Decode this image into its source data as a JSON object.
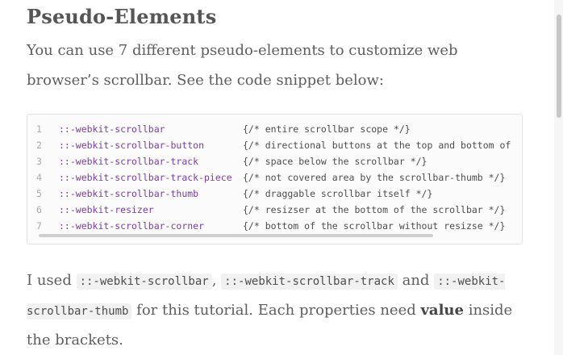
{
  "heading": "Pseudo-Elements",
  "intro": "You can use 7 different pseudo-elements to customize web browser’s scrollbar. See the code snippet below:",
  "code_lines": [
    {
      "num": "1",
      "selector": "::-webkit-scrollbar",
      "comment": "{/* entire scrollbar scope */}"
    },
    {
      "num": "2",
      "selector": "::-webkit-scrollbar-button",
      "comment": "{/* directional buttons at the top and bottom of"
    },
    {
      "num": "3",
      "selector": "::-webkit-scrollbar-track",
      "comment": "{/* space below the scrollbar */}"
    },
    {
      "num": "4",
      "selector": "::-webkit-scrollbar-track-piece",
      "comment": "{/* not covered area by the scrollbar-thumb */}"
    },
    {
      "num": "5",
      "selector": "::-webkit-scrollbar-thumb",
      "comment": "{/* draggable scrollbar itself */}"
    },
    {
      "num": "6",
      "selector": "::-webkit-resizer",
      "comment": "{/* resizser at the bottom of the scrollbar */}"
    },
    {
      "num": "7",
      "selector": "::-webkit-scrollbar-corner",
      "comment": "{/* bottom of the scrollbar without resizse */}"
    }
  ],
  "paragraph": {
    "t1": "I used ",
    "c1": "::-webkit-scrollbar",
    "t2": ", ",
    "c2": "::-webkit-scrollbar-track",
    "t3": " and ",
    "c3": "::-webkit-scrollbar-thumb",
    "t4": " for this tutorial. Each properties need ",
    "bold": "value",
    "t5": " inside the brackets."
  },
  "colors": {
    "selector": "#7a3e9d",
    "comment": "#4d4d4d",
    "line_number": "#aaaaaa",
    "text": "#5e5e5e"
  }
}
